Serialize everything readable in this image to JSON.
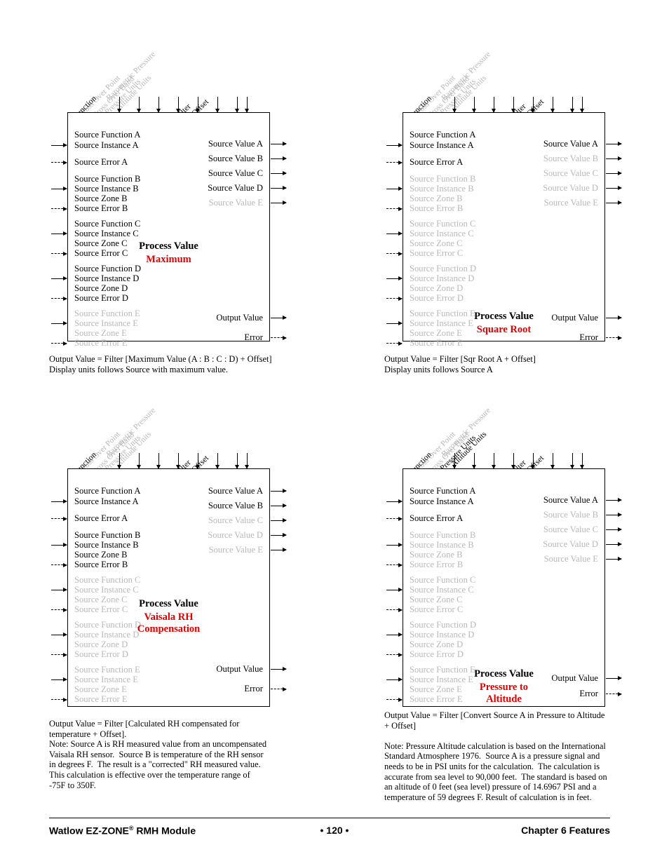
{
  "diagrams": [
    {
      "id": "maximum",
      "top_labels": [
        "Barometric Pressure",
        "Altitude Units",
        "Pressure Units",
        "Cross Over Band",
        "Cross Over Point",
        "Function",
        "Filter",
        "Offset"
      ],
      "title": "Process Value",
      "subtitle": "Maximum",
      "inputs": [
        {
          "text": "Source Function A",
          "gray": false,
          "arrow": "none"
        },
        {
          "text": "Source Instance A",
          "gray": false,
          "arrow": "solid"
        },
        {
          "text": "Source Error A",
          "gray": false,
          "arrow": "dashed"
        },
        {
          "text": "Source Function B",
          "gray": false,
          "arrow": "none"
        },
        {
          "text": "Source Instance B",
          "gray": false,
          "arrow": "solid"
        },
        {
          "text": "Source Zone B",
          "gray": false,
          "arrow": "none"
        },
        {
          "text": "Source Error B",
          "gray": false,
          "arrow": "dashed"
        },
        {
          "text": "Source Function C",
          "gray": false,
          "arrow": "none"
        },
        {
          "text": "Source Instance C",
          "gray": false,
          "arrow": "solid"
        },
        {
          "text": "Source Zone C",
          "gray": false,
          "arrow": "none"
        },
        {
          "text": "Source Error C",
          "gray": false,
          "arrow": "dashed"
        },
        {
          "text": "Source Function D",
          "gray": false,
          "arrow": "none"
        },
        {
          "text": "Source Instance D",
          "gray": false,
          "arrow": "solid"
        },
        {
          "text": "Source Zone D",
          "gray": false,
          "arrow": "none"
        },
        {
          "text": "Source Error D",
          "gray": false,
          "arrow": "dashed"
        },
        {
          "text": "Source Function E",
          "gray": true,
          "arrow": "none"
        },
        {
          "text": "Source Instance E",
          "gray": true,
          "arrow": "solid"
        },
        {
          "text": "Source Zone E",
          "gray": true,
          "arrow": "none"
        },
        {
          "text": "Source Error E",
          "gray": true,
          "arrow": "dashed"
        }
      ],
      "outputs": [
        {
          "text": "Source Value A",
          "gray": false,
          "arrow": "solid"
        },
        {
          "text": "Source Value B",
          "gray": false,
          "arrow": "solid"
        },
        {
          "text": "Source Value C",
          "gray": false,
          "arrow": "solid"
        },
        {
          "text": "Source Value D",
          "gray": false,
          "arrow": "solid"
        },
        {
          "text": "Source Value E",
          "gray": true,
          "arrow": "solid"
        },
        {
          "text": "Output Value",
          "gray": false,
          "arrow": "solid"
        },
        {
          "text": "Error",
          "gray": false,
          "arrow": "dashed"
        }
      ],
      "caption": "Output Value = Filter [Maximum Value (A : B : C : D) + Offset]\nDisplay units follows Source with maximum value."
    },
    {
      "id": "square-root",
      "top_labels": [
        "Barometric Pressure",
        "Altitude Units",
        "Pressure Units",
        "Cross Over Band",
        "Cross Over Point",
        "Function",
        "Filter",
        "Offset"
      ],
      "title": "Process Value",
      "subtitle": "Square Root",
      "inputs": [
        {
          "text": "Source Function A",
          "gray": false,
          "arrow": "none"
        },
        {
          "text": "Source Instance A",
          "gray": false,
          "arrow": "solid"
        },
        {
          "text": "Source Error A",
          "gray": false,
          "arrow": "dashed"
        },
        {
          "text": "Source Function B",
          "gray": true,
          "arrow": "none"
        },
        {
          "text": "Source Instance B",
          "gray": true,
          "arrow": "solid"
        },
        {
          "text": "Source Zone B",
          "gray": true,
          "arrow": "none"
        },
        {
          "text": "Source Error B",
          "gray": true,
          "arrow": "dashed"
        },
        {
          "text": "Source Function C",
          "gray": true,
          "arrow": "none"
        },
        {
          "text": "Source Instance C",
          "gray": true,
          "arrow": "solid"
        },
        {
          "text": "Source Zone C",
          "gray": true,
          "arrow": "none"
        },
        {
          "text": "Source Error C",
          "gray": true,
          "arrow": "dashed"
        },
        {
          "text": "Source Function D",
          "gray": true,
          "arrow": "none"
        },
        {
          "text": "Source Instance D",
          "gray": true,
          "arrow": "solid"
        },
        {
          "text": "Source Zone D",
          "gray": true,
          "arrow": "none"
        },
        {
          "text": "Source Error D",
          "gray": true,
          "arrow": "dashed"
        },
        {
          "text": "Source Function E",
          "gray": true,
          "arrow": "none"
        },
        {
          "text": "Source Instance E",
          "gray": true,
          "arrow": "solid"
        },
        {
          "text": "Source Zone E",
          "gray": true,
          "arrow": "none"
        },
        {
          "text": "Source Error E",
          "gray": true,
          "arrow": "dashed"
        }
      ],
      "outputs": [
        {
          "text": "Source Value A",
          "gray": false,
          "arrow": "solid"
        },
        {
          "text": "Source Value B",
          "gray": true,
          "arrow": "solid"
        },
        {
          "text": "Source Value C",
          "gray": true,
          "arrow": "solid"
        },
        {
          "text": "Source Value D",
          "gray": true,
          "arrow": "solid"
        },
        {
          "text": "Source Value E",
          "gray": true,
          "arrow": "solid"
        },
        {
          "text": "Output Value",
          "gray": false,
          "arrow": "solid"
        },
        {
          "text": "Error",
          "gray": false,
          "arrow": "dashed"
        }
      ],
      "caption": "Output Value = Filter [Sqr Root A + Offset]\nDisplay units follows Source A"
    },
    {
      "id": "vaisala-rh-compensation",
      "top_labels": [
        "Barometric Pressure",
        "Altitude Units",
        "Pressure Units",
        "Cross Over Band",
        "Cross Over Point",
        "Function",
        "Filter",
        "Offset"
      ],
      "title": "Process Value",
      "subtitle": "Vaisala RH\nCompensation",
      "inputs": [
        {
          "text": "Source Function A",
          "gray": false,
          "arrow": "none"
        },
        {
          "text": "Source Instance A",
          "gray": false,
          "arrow": "solid"
        },
        {
          "text": "Source Error A",
          "gray": false,
          "arrow": "dashed"
        },
        {
          "text": "Source Function B",
          "gray": false,
          "arrow": "none"
        },
        {
          "text": "Source Instance B",
          "gray": false,
          "arrow": "solid"
        },
        {
          "text": "Source Zone B",
          "gray": false,
          "arrow": "none"
        },
        {
          "text": "Source Error B",
          "gray": false,
          "arrow": "dashed"
        },
        {
          "text": "Source Function C",
          "gray": true,
          "arrow": "none"
        },
        {
          "text": "Source Instance C",
          "gray": true,
          "arrow": "solid"
        },
        {
          "text": "Source Zone C",
          "gray": true,
          "arrow": "none"
        },
        {
          "text": "Source Error C",
          "gray": true,
          "arrow": "dashed"
        },
        {
          "text": "Source Function D",
          "gray": true,
          "arrow": "none"
        },
        {
          "text": "Source Instance D",
          "gray": true,
          "arrow": "solid"
        },
        {
          "text": "Source Zone D",
          "gray": true,
          "arrow": "none"
        },
        {
          "text": "Source Error D",
          "gray": true,
          "arrow": "dashed"
        },
        {
          "text": "Source Function E",
          "gray": true,
          "arrow": "none"
        },
        {
          "text": "Source Instance E",
          "gray": true,
          "arrow": "solid"
        },
        {
          "text": "Source Zone E",
          "gray": true,
          "arrow": "none"
        },
        {
          "text": "Source Error E",
          "gray": true,
          "arrow": "dashed"
        }
      ],
      "outputs": [
        {
          "text": "Source Value A",
          "gray": false,
          "arrow": "solid"
        },
        {
          "text": "Source Value B",
          "gray": false,
          "arrow": "solid"
        },
        {
          "text": "Source Value C",
          "gray": true,
          "arrow": "solid"
        },
        {
          "text": "Source Value D",
          "gray": true,
          "arrow": "solid"
        },
        {
          "text": "Source Value E",
          "gray": true,
          "arrow": "solid"
        },
        {
          "text": "Output Value",
          "gray": false,
          "arrow": "solid"
        },
        {
          "text": "Error",
          "gray": false,
          "arrow": "dashed"
        }
      ],
      "caption": "Output Value = Filter [Calculated RH compensated for temperature + Offset].\nNote: Source A is RH measured value from an uncompensated Vaisala RH sensor.  Source B is temperature of the RH sensor in degrees F.  The result is a \"corrected\" RH measured value.  This calculation is effective over the temperature range of -75F to 350F."
    },
    {
      "id": "pressure-to-altitude",
      "top_labels": [
        "Barometric Pressure",
        "Altitude Units",
        "Pressure Units",
        "Cross Over Band",
        "Cross Over Point",
        "Function",
        "Filter",
        "Offset"
      ],
      "title": "Process Value",
      "subtitle": "Pressure to\nAltitude",
      "inputs": [
        {
          "text": "Source Function A",
          "gray": false,
          "arrow": "none"
        },
        {
          "text": "Source Instance A",
          "gray": false,
          "arrow": "solid"
        },
        {
          "text": "Source Error A",
          "gray": false,
          "arrow": "dashed"
        },
        {
          "text": "Source Function B",
          "gray": true,
          "arrow": "none"
        },
        {
          "text": "Source Instance B",
          "gray": true,
          "arrow": "solid"
        },
        {
          "text": "Source Zone B",
          "gray": true,
          "arrow": "none"
        },
        {
          "text": "Source Error B",
          "gray": true,
          "arrow": "dashed"
        },
        {
          "text": "Source Function C",
          "gray": true,
          "arrow": "none"
        },
        {
          "text": "Source Instance C",
          "gray": true,
          "arrow": "solid"
        },
        {
          "text": "Source Zone C",
          "gray": true,
          "arrow": "none"
        },
        {
          "text": "Source Error C",
          "gray": true,
          "arrow": "dashed"
        },
        {
          "text": "Source Function D",
          "gray": true,
          "arrow": "none"
        },
        {
          "text": "Source Instance D",
          "gray": true,
          "arrow": "solid"
        },
        {
          "text": "Source Zone D",
          "gray": true,
          "arrow": "none"
        },
        {
          "text": "Source Error D",
          "gray": true,
          "arrow": "dashed"
        },
        {
          "text": "Source Function E",
          "gray": true,
          "arrow": "none"
        },
        {
          "text": "Source Instance E",
          "gray": true,
          "arrow": "solid"
        },
        {
          "text": "Source Zone E",
          "gray": true,
          "arrow": "none"
        },
        {
          "text": "Source Error E",
          "gray": true,
          "arrow": "dashed"
        }
      ],
      "outputs": [
        {
          "text": "Source Value A",
          "gray": false,
          "arrow": "solid"
        },
        {
          "text": "Source Value B",
          "gray": true,
          "arrow": "solid"
        },
        {
          "text": "Source Value C",
          "gray": true,
          "arrow": "solid"
        },
        {
          "text": "Source Value D",
          "gray": true,
          "arrow": "solid"
        },
        {
          "text": "Source Value E",
          "gray": true,
          "arrow": "solid"
        },
        {
          "text": "Output Value",
          "gray": false,
          "arrow": "solid"
        },
        {
          "text": "Error",
          "gray": false,
          "arrow": "dashed"
        }
      ],
      "caption": "Output Value = Filter [Convert Source A in Pressure to Altitude + Offset]\n\nNote: Pressure Altitude calculation is based on the International Standard Atmosphere 1976.  Source A is a pressure signal and needs to be in PSI units for the calculation.  The calculation is accurate from sea level to 90,000 feet.  The standard is based on an altitude of 0 feet (sea level) pressure of 14.6967 PSI and a temperature of 59 degrees F. Result of calculation is in feet."
    }
  ],
  "footer": {
    "left_prefix": "Watlow EZ-ZONE",
    "left_reg": "®",
    "left_suffix": " RMH Module",
    "center": "•  120  •",
    "right": "Chapter 6 Features"
  },
  "colors": {
    "accent_red": "#e00000",
    "gray_text": "#b9b9b9"
  }
}
